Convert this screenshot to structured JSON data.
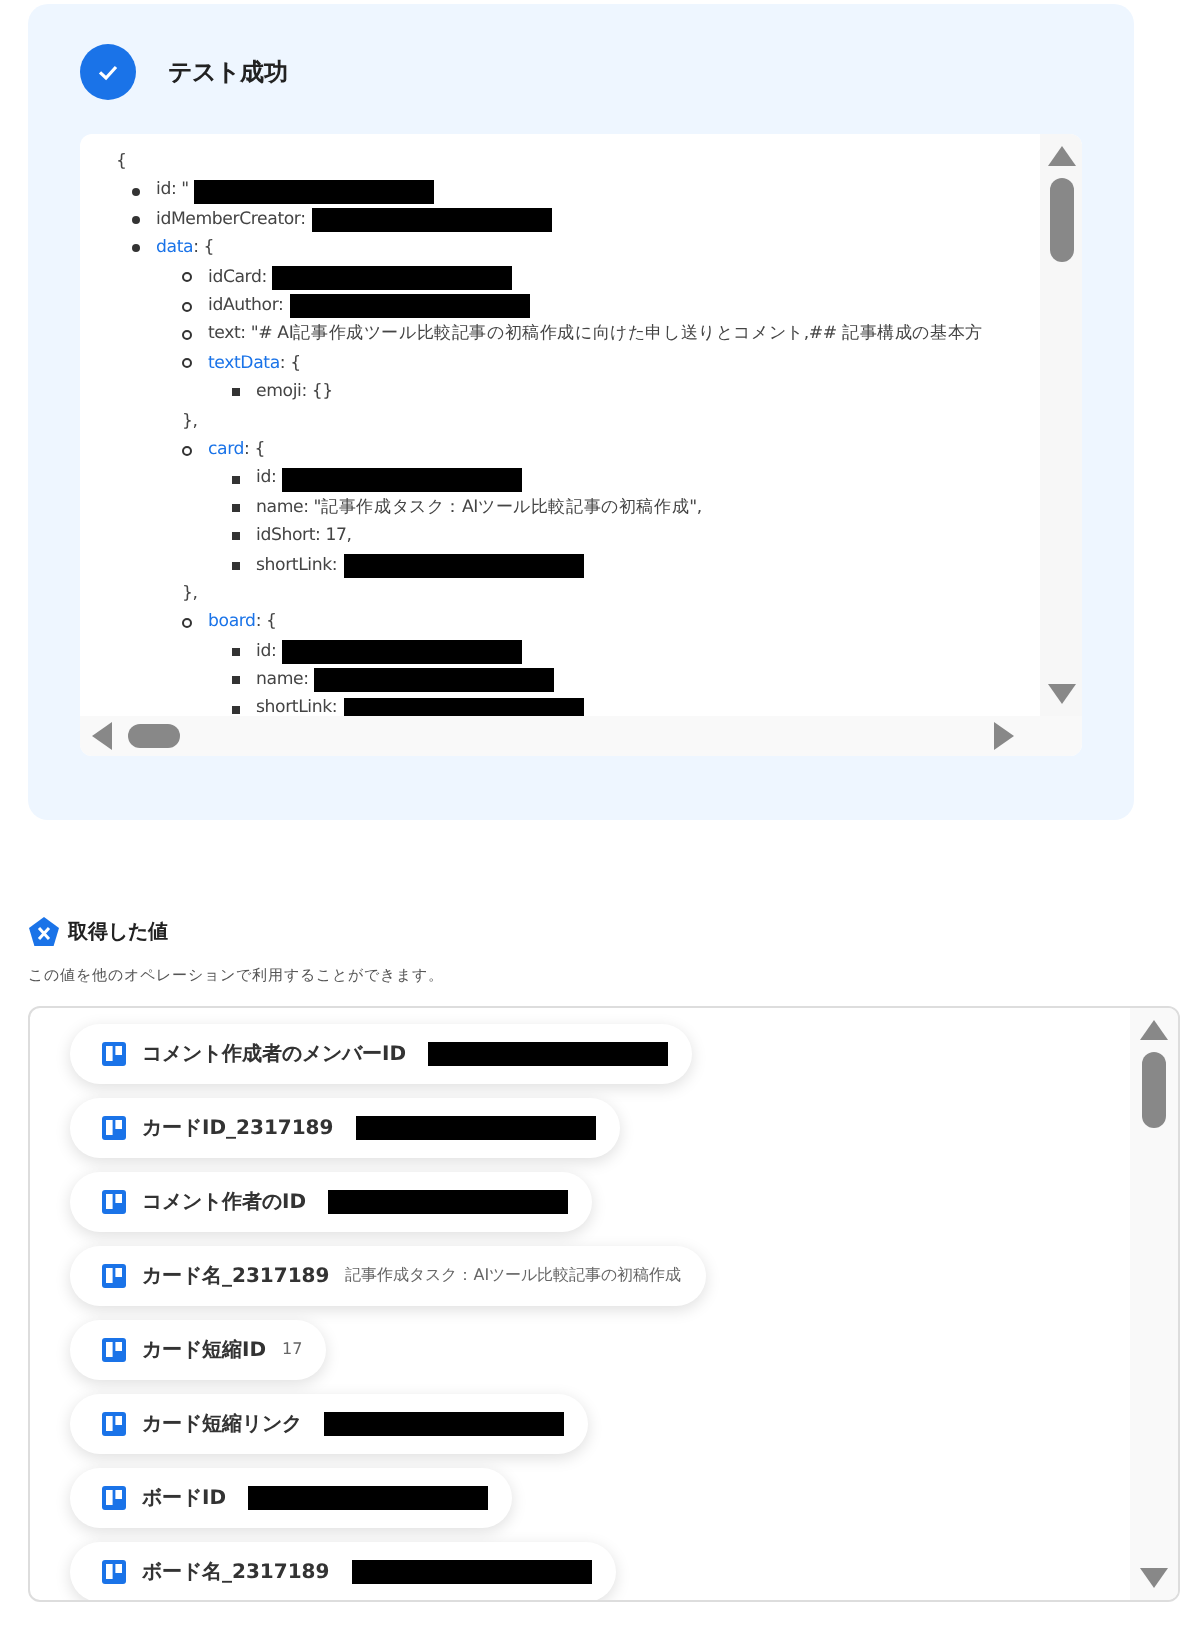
{
  "test_result": {
    "title": "テスト成功",
    "success": true
  },
  "json_view": {
    "open": "{",
    "items": [
      {
        "text": "id: \"",
        "redacted": true
      },
      {
        "text": "idMemberCreator: ",
        "redacted": true
      },
      {
        "label": "data",
        "suffix": ": {",
        "children": [
          {
            "text": "idCard: ",
            "redacted": true
          },
          {
            "text": "idAuthor:",
            "redacted": true
          },
          {
            "text": "text: \"# AI記事作成ツール比較記事の初稿作成に向けた申し送りとコメント,## 記事構成の基本方"
          },
          {
            "label": "textData",
            "suffix": ": {",
            "children": [
              {
                "text": "emoji: {}"
              }
            ],
            "closing": "},"
          },
          {
            "label": "card",
            "suffix": ": {",
            "children": [
              {
                "text": "id: ",
                "redacted": true
              },
              {
                "text": "name: \"記事作成タスク：AIツール比較記事の初稿作成\","
              },
              {
                "text": "idShort: 17,"
              },
              {
                "text": "shortLink: ",
                "redacted": true
              }
            ],
            "closing": "},"
          },
          {
            "label": "board",
            "suffix": ": {",
            "children": [
              {
                "text": "id:",
                "redacted": true
              },
              {
                "text": "name:",
                "redacted": true
              },
              {
                "text": "shortLink: ",
                "redacted": true
              }
            ]
          }
        ]
      }
    ]
  },
  "fetched_values": {
    "title": "取得した値",
    "description": "この値を他のオペレーションで利用することができます。",
    "items": [
      {
        "label": "コメント作成者のメンバーID",
        "redacted": true
      },
      {
        "label": "カードID_2317189",
        "redacted": true
      },
      {
        "label": "コメント作者のID",
        "redacted": true
      },
      {
        "label": "カード名_2317189",
        "value": "記事作成タスク：AIツール比較記事の初稿作成"
      },
      {
        "label": "カード短縮ID",
        "value": "17"
      },
      {
        "label": "カード短縮リンク",
        "redacted": true
      },
      {
        "label": "ボードID",
        "redacted": true
      },
      {
        "label": "ボード名_2317189",
        "redacted": true
      }
    ]
  }
}
